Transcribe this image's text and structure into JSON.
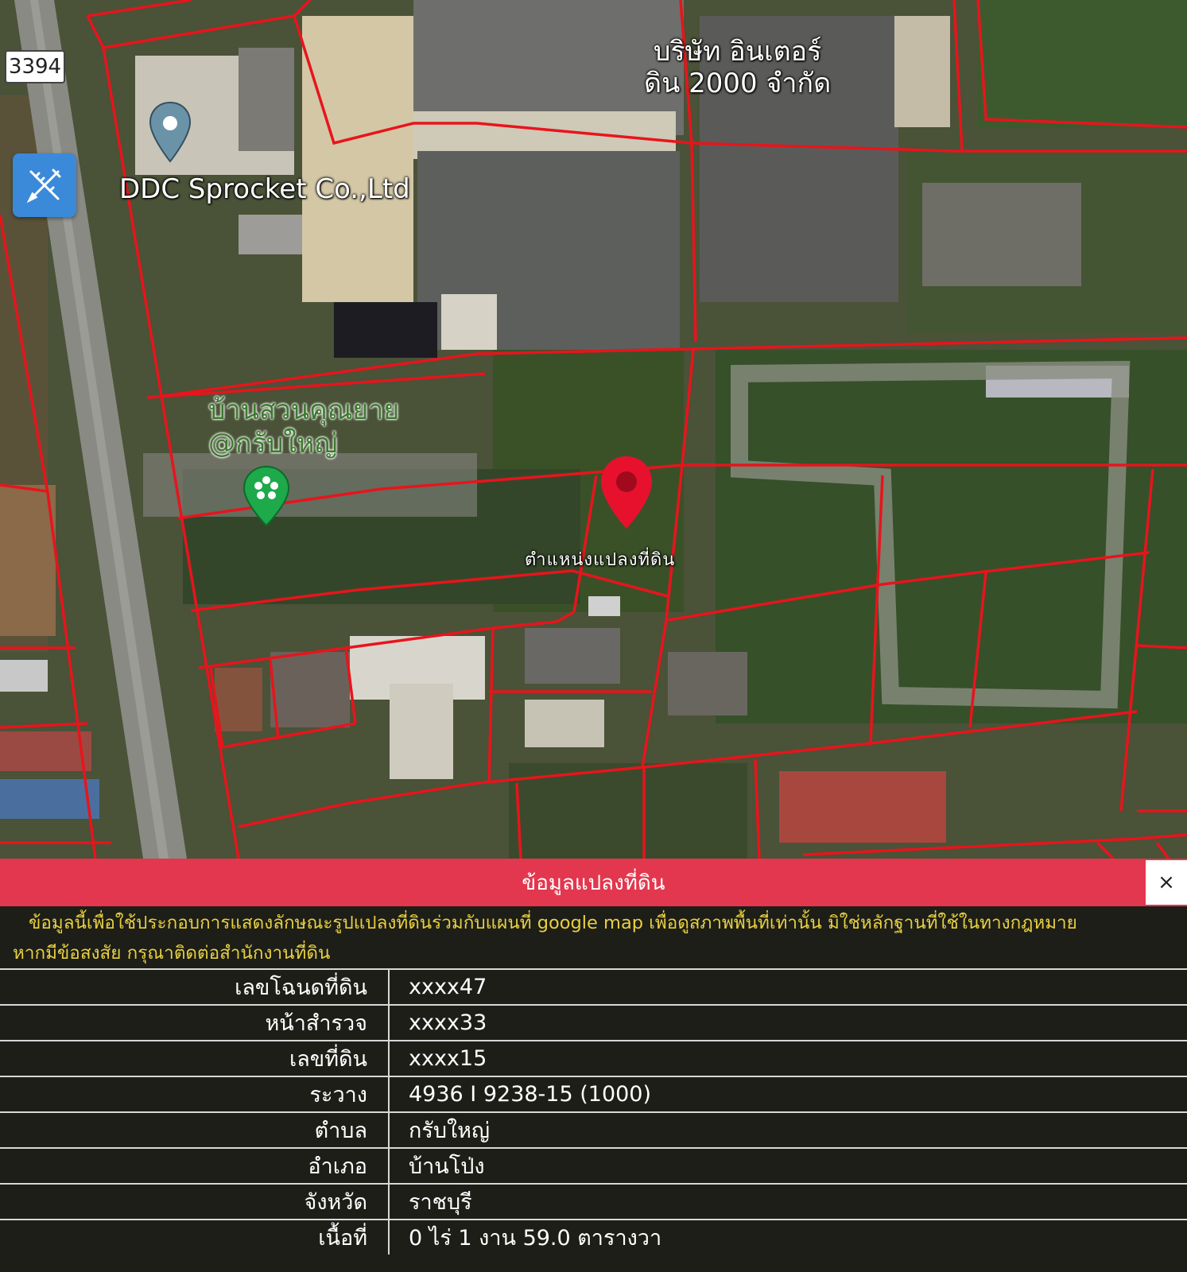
{
  "map": {
    "road_shield": "3394",
    "labels": {
      "company": "DDC Sprocket Co.,Ltd",
      "factory_line1": "บริษัท อินเตอร์",
      "factory_line2": "ดิน 2000 จำกัด",
      "garden_line1": "บ้านสวนคุณยาย",
      "garden_line2": "@กรับใหญ่",
      "parcel": "ตำแหน่งแปลงที่ดิน"
    },
    "colors": {
      "parcel_lines": "#e8141c",
      "pin": "#e8112d",
      "tool_button": "#3b8ad9"
    },
    "icons": {
      "tool": "pencil-ruler-icon",
      "pin": "location-pin-icon",
      "place": "place-pin-icon",
      "garden": "flower-pin-icon"
    }
  },
  "panel": {
    "title": "ข้อมูลแปลงที่ดิน",
    "close_label": "×",
    "disclaimer_line1": "ข้อมูลนี้เพื่อใช้ประกอบการแสดงลักษณะรูปแปลงที่ดินร่วมกับแผนที่ google map เพื่อดูสภาพพื้นที่เท่านั้น มิใช่หลักฐานที่ใช้ในทางกฎหมาย",
    "disclaimer_line2": "หากมีข้อสงสัย กรุณาติดต่อสำนักงานที่ดิน",
    "rows": [
      {
        "label": "เลขโฉนดที่ดิน",
        "value": "xxxx47"
      },
      {
        "label": "หน้าสำรวจ",
        "value": "xxxx33"
      },
      {
        "label": "เลขที่ดิน",
        "value": "xxxx15"
      },
      {
        "label": "ระวาง",
        "value": "4936 I 9238-15 (1000)"
      },
      {
        "label": "ตำบล",
        "value": "กรับใหญ่"
      },
      {
        "label": "อำเภอ",
        "value": "บ้านโป่ง"
      },
      {
        "label": "จังหวัด",
        "value": "ราชบุรี"
      },
      {
        "label": "เนื้อที่",
        "value": "0 ไร่ 1 งาน 59.0 ตารางวา"
      }
    ]
  }
}
